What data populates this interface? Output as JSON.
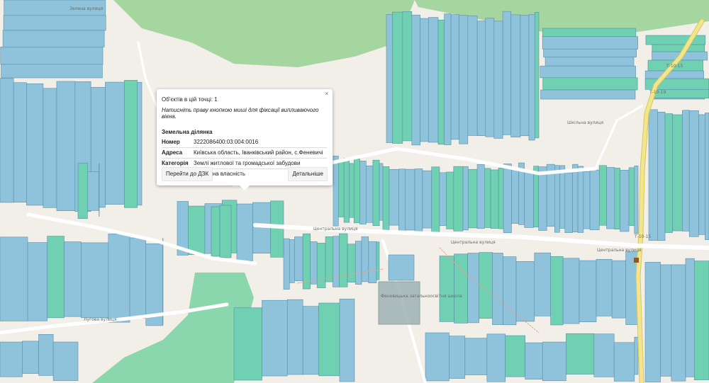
{
  "map": {
    "colors": {
      "background": "#f2efe9",
      "parcel_blue": "#8fc3db",
      "parcel_green": "#6fd0b2",
      "parcel_stroke": "#5a8fa8",
      "forest": "#a6d6a0",
      "road_main": "#f2e58e",
      "road": "#ffffff"
    },
    "labels": {
      "street_top_left": "Зелена вулиця",
      "street_mid": "Центральна вулиця",
      "street_center": "Центральна вулиця",
      "street_right": "Центральна вулиця",
      "street_left_bottom": "Лугова вулиця",
      "street_top_right": "Шкільна вулиця",
      "road_code_top": "Т-10-19",
      "road_code_mid": "Т-10-15",
      "road_code_right": "Т-10-15",
      "school": "Феневицька загальноосвітня школа"
    }
  },
  "popup": {
    "close": "×",
    "objects_count": "Об'єктів в цій точці: 1",
    "hint": "Натисніть праву кнопкою миші для фіксації випливаючого вікна.",
    "section_title": "Земельна ділянка",
    "rows": [
      {
        "key": "Номер",
        "value": "3222086400:03:004:0016"
      },
      {
        "key": "Адреса",
        "value": "Київська область, Іванківський район, с.Феневичі"
      },
      {
        "key": "Категорія",
        "value": "Землі житлової та громадської забудови"
      },
      {
        "key": "Власність",
        "value": "Приватна власність"
      }
    ],
    "button_dzk": "Перейти до ДЗК",
    "button_details": "Детальніше"
  }
}
